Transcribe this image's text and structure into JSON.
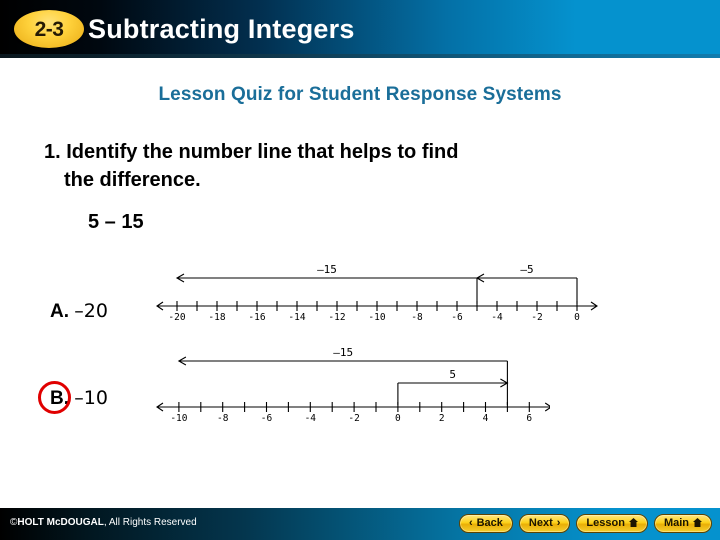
{
  "header": {
    "badge": "2-3",
    "title": "Subtracting Integers",
    "badge_color": "#ffd23c",
    "accent_color": "#0592ce"
  },
  "quiz": {
    "subtitle": "Lesson Quiz for Student Response Systems",
    "subtitle_color": "#1a6e99",
    "question_number": "1.",
    "question_text": "Identify the number line that helps to find",
    "question_text_line2": "the difference.",
    "expression": "5 – 15"
  },
  "choices": [
    {
      "letter": "A.",
      "value": "–20",
      "correct": false
    },
    {
      "letter": "B.",
      "value": "–10",
      "correct": true,
      "marker_color": "#e00000"
    }
  ],
  "chart_data": [
    {
      "type": "numberline",
      "id": "numberline-a",
      "choice": "A",
      "axis_min": -21,
      "axis_max": 1,
      "tick_step": 1,
      "tick_labels": [
        "-20",
        "-18",
        "-16",
        "-14",
        "-12",
        "-10",
        "-8",
        "-6",
        "-4",
        "-2",
        "0"
      ],
      "tick_label_values": [
        -20,
        -18,
        -16,
        -14,
        -12,
        -10,
        -8,
        -6,
        -4,
        -2,
        0
      ],
      "left_arrow": true,
      "right_arrow": true,
      "jumps": [
        {
          "label": "–5",
          "from": 0,
          "to": -5,
          "direction": "left",
          "row": 0
        },
        {
          "label": "–15",
          "from": -5,
          "to": -20,
          "direction": "left",
          "row": 0
        }
      ]
    },
    {
      "type": "numberline",
      "id": "numberline-b",
      "choice": "B",
      "axis_min": -11,
      "axis_max": 7,
      "tick_step": 1,
      "tick_labels": [
        "-10",
        "-8",
        "-6",
        "-4",
        "-2",
        "0",
        "2",
        "4",
        "6"
      ],
      "tick_label_values": [
        -10,
        -8,
        -6,
        -4,
        -2,
        0,
        2,
        4,
        6
      ],
      "left_arrow": true,
      "right_arrow": true,
      "jumps": [
        {
          "label": "5",
          "from": 0,
          "to": 5,
          "direction": "right",
          "row": 1
        },
        {
          "label": "–15",
          "from": 5,
          "to": -10,
          "direction": "left",
          "row": 0
        }
      ]
    }
  ],
  "footer": {
    "copyright_symbol": "©",
    "copyright_brand": "HOLT McDOUGAL",
    "copyright_rest": ", All Rights Reserved",
    "buttons": [
      {
        "label": "Back",
        "icon": "chevron-left",
        "glyph": "‹"
      },
      {
        "label": "Next",
        "icon": "chevron-right",
        "glyph": "›"
      },
      {
        "label": "Lesson",
        "icon": "home",
        "glyph": "⌂"
      },
      {
        "label": "Main",
        "icon": "home",
        "glyph": "⌂"
      }
    ]
  }
}
